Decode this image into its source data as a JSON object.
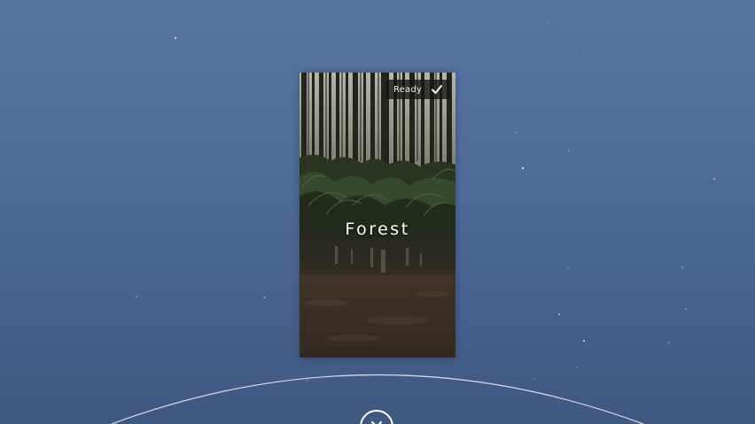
{
  "environment_card": {
    "title": "Forest",
    "status_label": "Ready",
    "status_icon": "checkmark-icon"
  },
  "controls": {
    "close_icon": "close-icon"
  },
  "colors": {
    "background_top": "#5a75a3",
    "background_bottom": "#40577f",
    "badge_background": "#141612",
    "text": "#ffffff"
  }
}
